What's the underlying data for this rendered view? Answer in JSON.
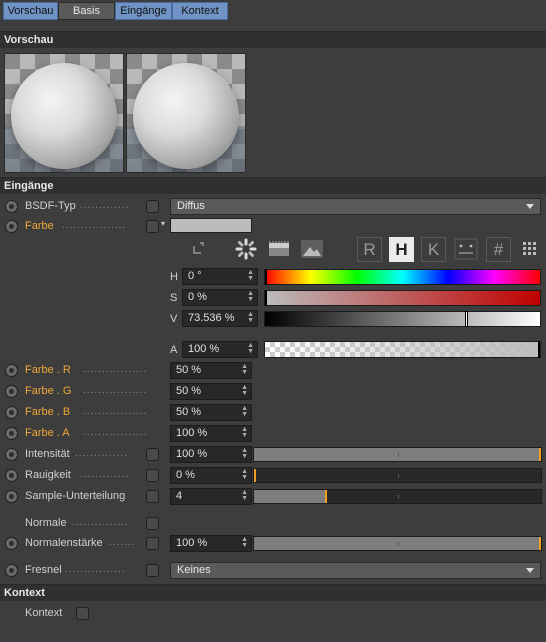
{
  "tabs": [
    {
      "label": "Vorschau",
      "active": true
    },
    {
      "label": "Basis",
      "active": false
    },
    {
      "label": "Eingänge",
      "active": true
    },
    {
      "label": "Kontext",
      "active": true
    }
  ],
  "sections": {
    "vorschau": "Vorschau",
    "eingaenge": "Eingänge",
    "kontext": "Kontext"
  },
  "bsdf": {
    "label": "BSDF-Typ",
    "value": "Diffus"
  },
  "farbe": {
    "label": "Farbe",
    "swatch": "#bcbcbc"
  },
  "color_modes": [
    "R",
    "H",
    "K",
    "#"
  ],
  "hsv": {
    "h": {
      "label": "H",
      "value": "0 °"
    },
    "s": {
      "label": "S",
      "value": "0 %"
    },
    "v": {
      "label": "V",
      "value": "73.536 %",
      "level": 0.73536
    }
  },
  "alpha": {
    "label": "A",
    "value": "100 %"
  },
  "channels": [
    {
      "label": "Farbe . R",
      "value": "50 %"
    },
    {
      "label": "Farbe . G",
      "value": "50 %"
    },
    {
      "label": "Farbe . B",
      "value": "50 %"
    },
    {
      "label": "Farbe . A",
      "value": "100 %"
    }
  ],
  "params": [
    {
      "label": "Intensität",
      "value": "100 %",
      "level": 1.0
    },
    {
      "label": "Rauigkeit",
      "value": "0 %",
      "level": 0.0
    },
    {
      "label": "Sample-Unterteilung",
      "value": "4",
      "level": 0.25
    }
  ],
  "normale": {
    "label": "Normale"
  },
  "normalenstaerke": {
    "label": "Normalenstärke",
    "value": "100 %",
    "level": 1.0
  },
  "fresnel": {
    "label": "Fresnel",
    "value": "Keines"
  },
  "kontext_param": {
    "label": "Kontext"
  },
  "colors": {
    "accent_blue": "#6f93c4",
    "orange": "#f0a63a",
    "slider_mark": "#f0a020"
  }
}
